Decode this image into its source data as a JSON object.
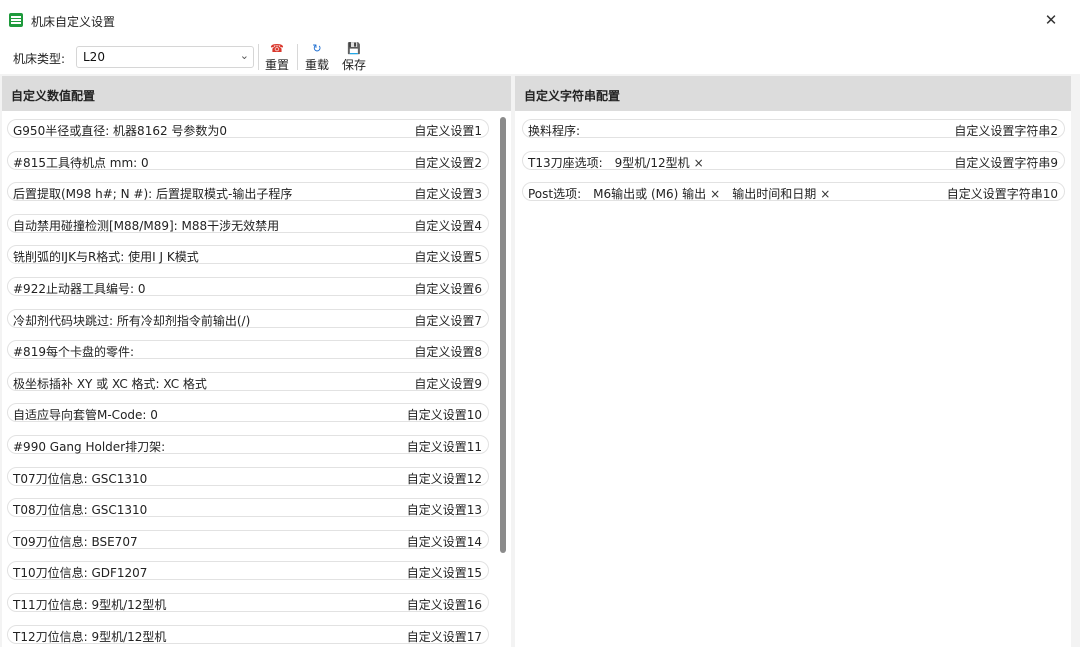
{
  "window": {
    "title": "机床自定义设置",
    "close": "✕"
  },
  "toolbar": {
    "machine_type_label": "机床类型:",
    "machine_type_value": "L20",
    "reset_label": "重置",
    "reload_label": "重载",
    "save_label": "保存"
  },
  "numeric_panel": {
    "header": "自定义数值配置",
    "rows": [
      {
        "text": "G950半径或直径:  机器8162 号参数为0",
        "config": "自定义设置1"
      },
      {
        "text": "#815工具待机点 mm:  0",
        "config": "自定义设置2"
      },
      {
        "text": "后置提取(M98 h#;  N #):  后置提取模式-输出子程序",
        "config": "自定义设置3"
      },
      {
        "text": "自动禁用碰撞检测[M88/M89]:  M88干涉无效禁用",
        "config": "自定义设置4"
      },
      {
        "text": "铣削弧的IJK与R格式:  使用I J K模式",
        "config": "自定义设置5"
      },
      {
        "text": "#922止动器工具编号:  0",
        "config": "自定义设置6"
      },
      {
        "text": "冷却剂代码块跳过:  所有冷却剂指令前输出(/)",
        "config": "自定义设置7"
      },
      {
        "text": "#819每个卡盘的零件:",
        "config": "自定义设置8"
      },
      {
        "text": "极坐标插补 XY 或 XC 格式:  XC 格式",
        "config": "自定义设置9"
      },
      {
        "text": "自适应导向套管M-Code:  0",
        "config": "自定义设置10"
      },
      {
        "text": "#990 Gang Holder排刀架:",
        "config": "自定义设置11"
      },
      {
        "text": "T07刀位信息:  GSC1310",
        "config": "自定义设置12"
      },
      {
        "text": "T08刀位信息:  GSC1310",
        "config": "自定义设置13"
      },
      {
        "text": "T09刀位信息:  BSE707",
        "config": "自定义设置14"
      },
      {
        "text": "T10刀位信息:  GDF1207",
        "config": "自定义设置15"
      },
      {
        "text": "T11刀位信息:  9型机/12型机",
        "config": "自定义设置16"
      },
      {
        "text": "T12刀位信息:  9型机/12型机",
        "config": "自定义设置17"
      }
    ]
  },
  "string_panel": {
    "header": "自定义字符串配置",
    "rows": [
      {
        "text": "换料程序:",
        "tags": [],
        "config": "自定义设置字符串2"
      },
      {
        "text": "T13刀座选项:",
        "tags": [
          "9型机/12型机"
        ],
        "config": "自定义设置字符串9"
      },
      {
        "text": "Post选项:",
        "tags": [
          "M6输出或 (M6) 输出",
          "输出时间和日期"
        ],
        "config": "自定义设置字符串10"
      }
    ]
  },
  "colors": {
    "header_bg": "#dcdcdc",
    "reset_icon": "#d9372c",
    "reload_icon": "#1f6fd1",
    "save_icon": "#1f6fd1",
    "app_icon": "#1e9a3c"
  },
  "icons": {
    "reset": "reset-icon",
    "reload": "reload-icon",
    "save": "save-icon"
  }
}
